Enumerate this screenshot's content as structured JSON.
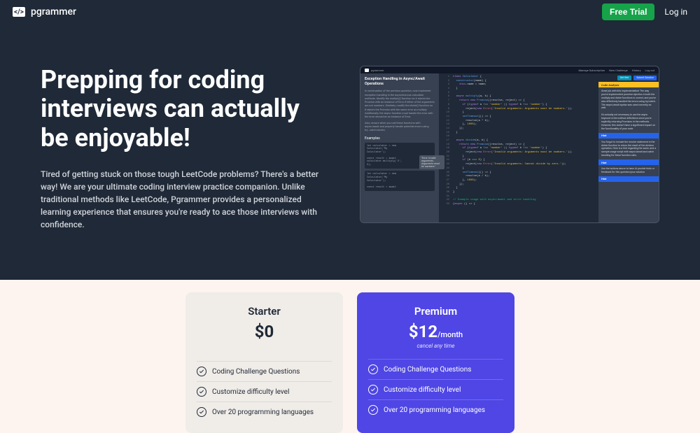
{
  "nav": {
    "brand": "pgrammer",
    "free_trial": "Free Trial",
    "login": "Log in"
  },
  "hero": {
    "title": "Prepping for coding interviews can actually be enjoyable!",
    "description": "Tired of getting stuck on those tough LeetCode problems? There's a better way! We are your ultimate coding interview practice companion. Unlike traditional methods like LeetCode, Pgrammer provides a personalized learning experience that ensures you're ready to ace those interviews with confidence."
  },
  "screenshot": {
    "brand": "pgrammer",
    "nav_items": [
      "Manage Subscription",
      "New Challenge",
      "History",
      "Log out"
    ],
    "problem_title": "Exception Handling in Async/Await Operations",
    "problem_desc": "In continuation of the previous question, now implement exception handling in the asynchronous calculator methods. Modify the multiply() function so it rejects the Promise with an instance of Error if either of the arguments are not numbers. Similarly, modify the divide() function so it rejects the Promise with the same error as multiply. Additionally, the async function must handle the error with the error should be an instance of Error.",
    "problem_desc2": "Also, ensure when you call these functions with async/await and properly handle potential errors using try...catch blocks.",
    "examples_label": "Examples",
    "example1": "let calculator = new\nCalculator('My\nCalculator');\n\nconst result = await\ncalculator.multiply('2',\n3);",
    "error_tooltip": "\"Error: Invalid\narguments.\nArguments must\nbe numbers.\"",
    "example2": "let calculator = new\nCalculator('My\nCalculator');\n\nconst result = await",
    "hint_btn": "Get Hint",
    "submit_btn": "Submit Solution",
    "analysis_header": "Code Analysis",
    "analysis_text": "Great job with this implementation! The way you've implemented promise rejection in both the multiply and divide functions is correct, and you've also effectively handled the errors using try/catch. The async/await syntax was used correctly as well.\n\nIt's actually not necessary to use the async keyword in the method definitions since you're explicitly returning Promises in the methods. However, this doesn't have a significant impact on the functionality of your code.",
    "hint_header": "Hint",
    "hint_text1": "You forgot to include the resolve statement in the divide function to return the result of the division operation. Here is a hint regarding the same, and a sample usage script with async/await and catch handling for these function calls.",
    "hint_text2": "Use the buttons above to have AI provide hints or feedback for this question/your solution",
    "hint_label": "Hint"
  },
  "pricing": {
    "starter": {
      "name": "Starter",
      "price": "$0",
      "features": [
        "Coding Challenge Questions",
        "Customize difficulty level",
        "Over 20 programming languages"
      ]
    },
    "premium": {
      "name": "Premium",
      "price": "$12",
      "period": "/month",
      "cancel": "cancel any time",
      "features": [
        "Coding Challenge Questions",
        "Customize difficulty level",
        "Over 20 programming languages"
      ]
    }
  }
}
